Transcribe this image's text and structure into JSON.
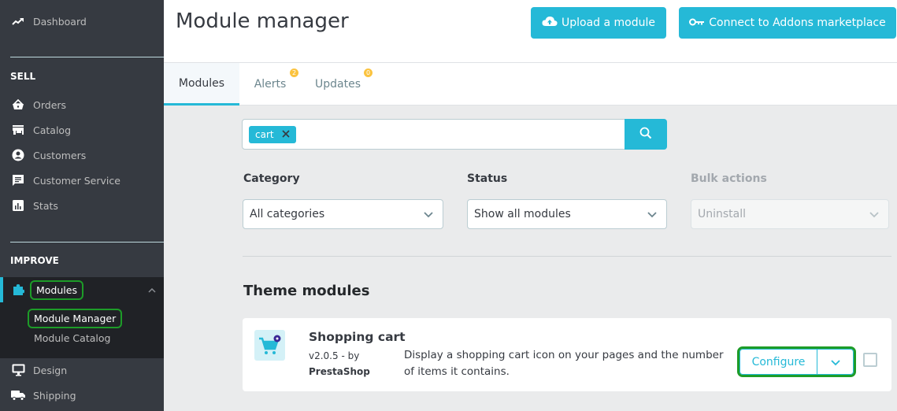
{
  "sidebar": {
    "dashboard": "Dashboard",
    "sell_heading": "SELL",
    "sell_items": [
      {
        "label": "Orders",
        "icon": "basket-icon"
      },
      {
        "label": "Catalog",
        "icon": "store-icon"
      },
      {
        "label": "Customers",
        "icon": "user-circle-icon"
      },
      {
        "label": "Customer Service",
        "icon": "chat-icon"
      },
      {
        "label": "Stats",
        "icon": "bar-chart-icon"
      }
    ],
    "improve_heading": "IMPROVE",
    "modules": {
      "label": "Modules",
      "expanded": true,
      "subitems": [
        {
          "label": "Module Manager",
          "active": true
        },
        {
          "label": "Module Catalog",
          "active": false
        }
      ]
    },
    "after_items": [
      {
        "label": "Design",
        "icon": "monitor-icon"
      },
      {
        "label": "Shipping",
        "icon": "truck-icon"
      }
    ]
  },
  "header": {
    "title": "Module manager",
    "upload_button": "Upload a module",
    "connect_button": "Connect to Addons marketplace"
  },
  "tabs": [
    {
      "label": "Modules",
      "active": true
    },
    {
      "label": "Alerts",
      "badge": "2"
    },
    {
      "label": "Updates",
      "badge": "0"
    }
  ],
  "search": {
    "tags": [
      "cart"
    ]
  },
  "filters": {
    "category": {
      "label": "Category",
      "value": "All categories"
    },
    "status": {
      "label": "Status",
      "value": "Show all modules"
    },
    "bulk": {
      "label": "Bulk actions",
      "value": "Uninstall",
      "disabled": true
    }
  },
  "section": {
    "title": "Theme modules"
  },
  "module": {
    "name": "Shopping cart",
    "version": "v2.0.5 - by",
    "author": "PrestaShop",
    "description": "Display a shopping cart icon on your pages and the number of items it contains.",
    "action": "Configure",
    "checked": false
  },
  "colors": {
    "accent": "#25b9d7",
    "sidebar_bg": "#363a41",
    "highlight": "#1d9c28",
    "badge": "#fab000"
  }
}
